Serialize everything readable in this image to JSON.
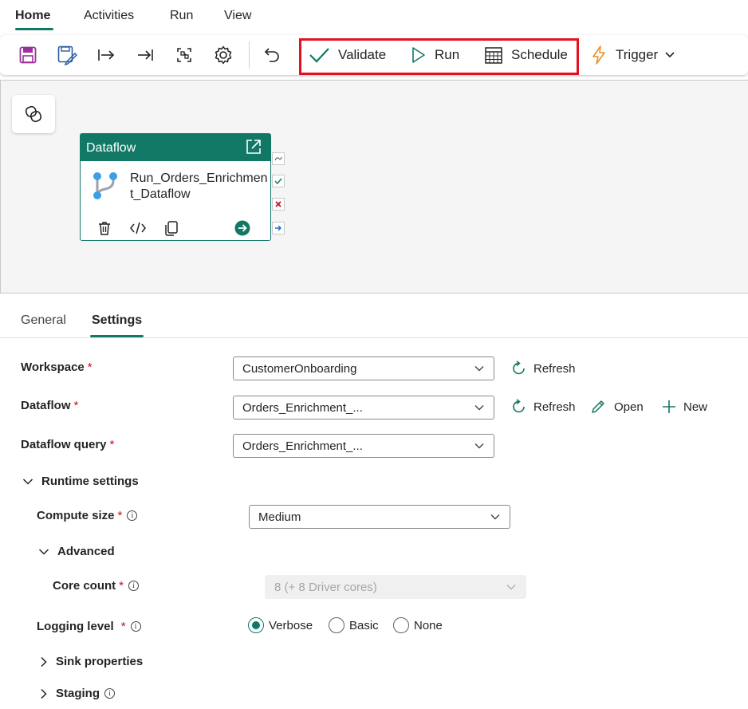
{
  "menu": {
    "tabs": [
      "Home",
      "Activities",
      "Run",
      "View"
    ]
  },
  "toolbar": {
    "icons": [
      "save-icon",
      "save-as-icon",
      "move-in-icon",
      "move-to-end-icon",
      "fit-view-icon",
      "settings-icon",
      "undo-icon"
    ],
    "validate_label": "Validate",
    "run_label": "Run",
    "schedule_label": "Schedule",
    "trigger_label": "Trigger"
  },
  "canvas": {
    "activity": {
      "type_label": "Dataflow",
      "name": "Run_Orders_Enrichment_Dataflow"
    }
  },
  "details_tabs": [
    "General",
    "Settings"
  ],
  "settings": {
    "workspace_label": "Workspace",
    "workspace_value": "CustomerOnboarding",
    "dataflow_label": "Dataflow",
    "dataflow_value": "Orders_Enrichment_...",
    "dataflow_query_label": "Dataflow query",
    "dataflow_query_value": "Orders_Enrichment_...",
    "refresh_label": "Refresh",
    "open_label": "Open",
    "new_label": "New",
    "runtime_settings_label": "Runtime settings",
    "compute_size_label": "Compute size",
    "compute_size_value": "Medium",
    "advanced_label": "Advanced",
    "core_count_label": "Core count",
    "core_count_value": "8 (+ 8 Driver cores)",
    "logging_level_label": "Logging level",
    "logging_options": [
      "Verbose",
      "Basic",
      "None"
    ],
    "logging_selected": "Verbose",
    "sink_properties_label": "Sink properties",
    "staging_label": "Staging",
    "required_marker": "*",
    "info_glyph": "i"
  },
  "colors": {
    "accent": "#117865",
    "highlight": "#e3121f",
    "required": "#c50f1f",
    "save_icon": "#9c2f9e",
    "trigger_icon": "#e8912d"
  }
}
